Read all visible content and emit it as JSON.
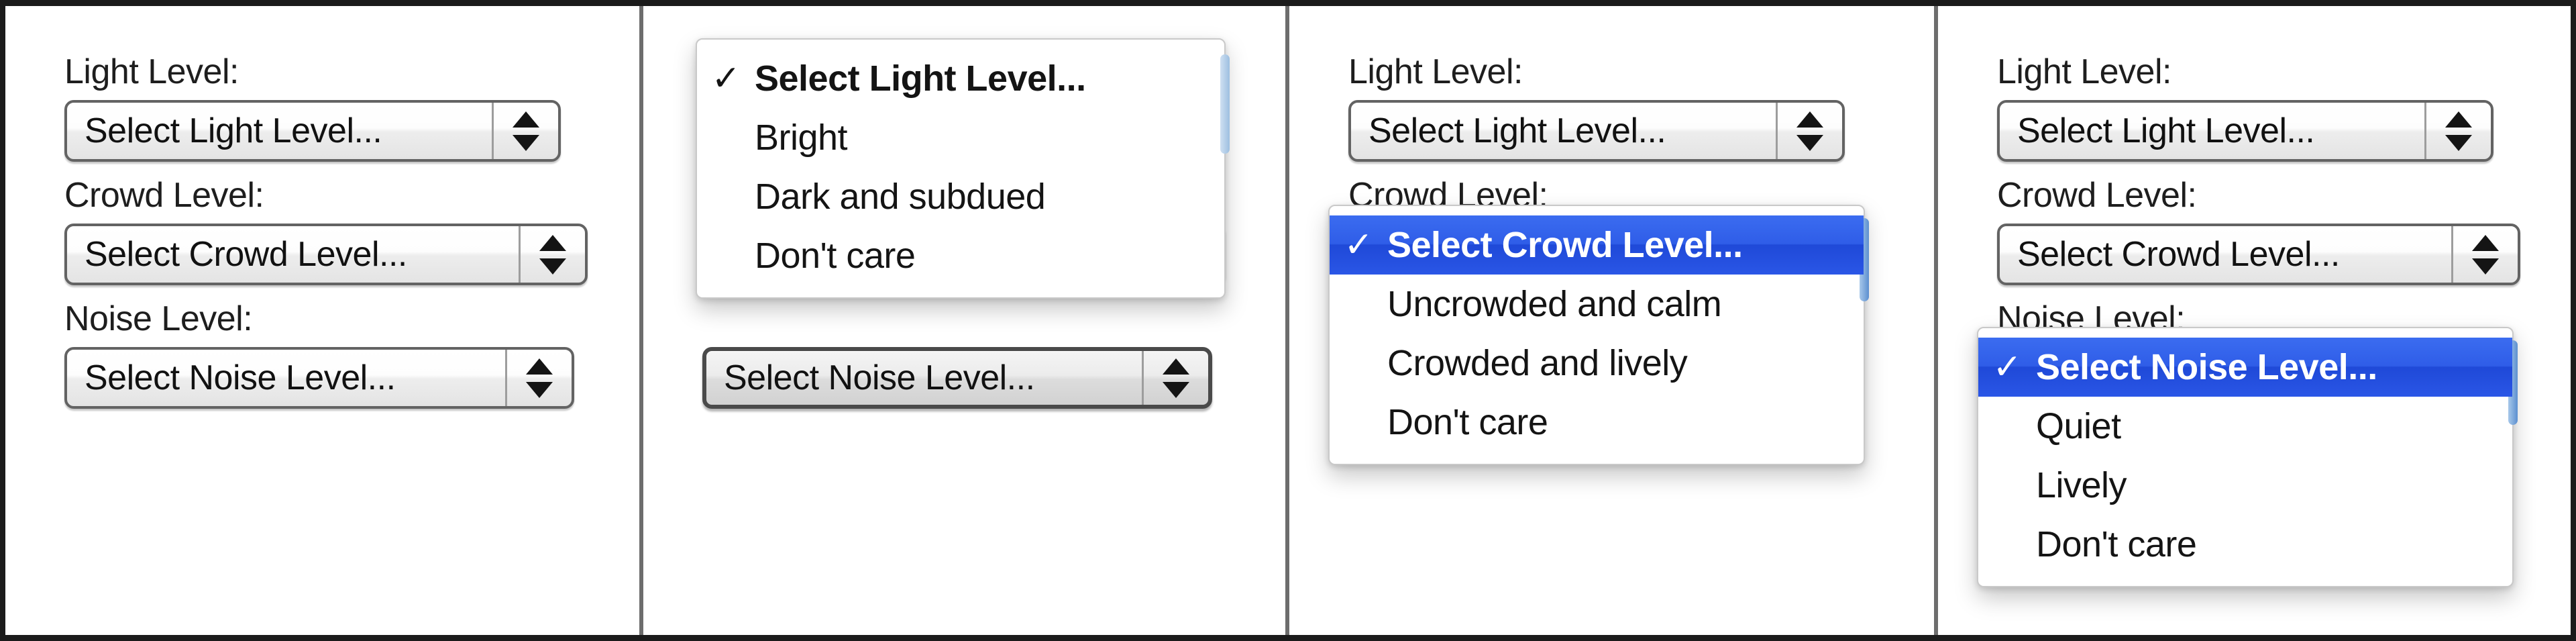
{
  "figure": {
    "panel_count": 4,
    "divider_color": "#6d6d6d",
    "border_color": "#1b1b1b",
    "highlight_color": "#2f5de8"
  },
  "labels": {
    "light": "Light Level:",
    "crowd": "Crowd Level:",
    "noise": "Noise Level:"
  },
  "popups": {
    "light": "Select Light Level...",
    "crowd": "Select Crowd Level...",
    "noise": "Select Noise Level..."
  },
  "checkmark": "✓",
  "panels": [
    {
      "name": "all-closed",
      "menu_open": null
    },
    {
      "name": "light-menu-open",
      "menu_open": "light",
      "menu": {
        "title_field": "Light Level:",
        "items": [
          {
            "label": "Select Light Level...",
            "checked": true,
            "selected": false
          },
          {
            "label": "Bright",
            "checked": false,
            "selected": false
          },
          {
            "label": "Dark and subdued",
            "checked": false,
            "selected": false
          },
          {
            "label": "Don't care",
            "checked": false,
            "selected": false
          }
        ]
      }
    },
    {
      "name": "crowd-menu-open",
      "menu_open": "crowd",
      "menu": {
        "title_field": "Crowd Level:",
        "items": [
          {
            "label": "Select Crowd Level...",
            "checked": true,
            "selected": true
          },
          {
            "label": "Uncrowded and calm",
            "checked": false,
            "selected": false
          },
          {
            "label": "Crowded and lively",
            "checked": false,
            "selected": false
          },
          {
            "label": "Don't care",
            "checked": false,
            "selected": false
          }
        ]
      }
    },
    {
      "name": "noise-menu-open",
      "menu_open": "noise",
      "menu": {
        "title_field": "Noise Level:",
        "items": [
          {
            "label": "Select Noise Level...",
            "checked": true,
            "selected": true
          },
          {
            "label": "Quiet",
            "checked": false,
            "selected": false
          },
          {
            "label": "Lively",
            "checked": false,
            "selected": false
          },
          {
            "label": "Don't care",
            "checked": false,
            "selected": false
          }
        ]
      }
    }
  ]
}
